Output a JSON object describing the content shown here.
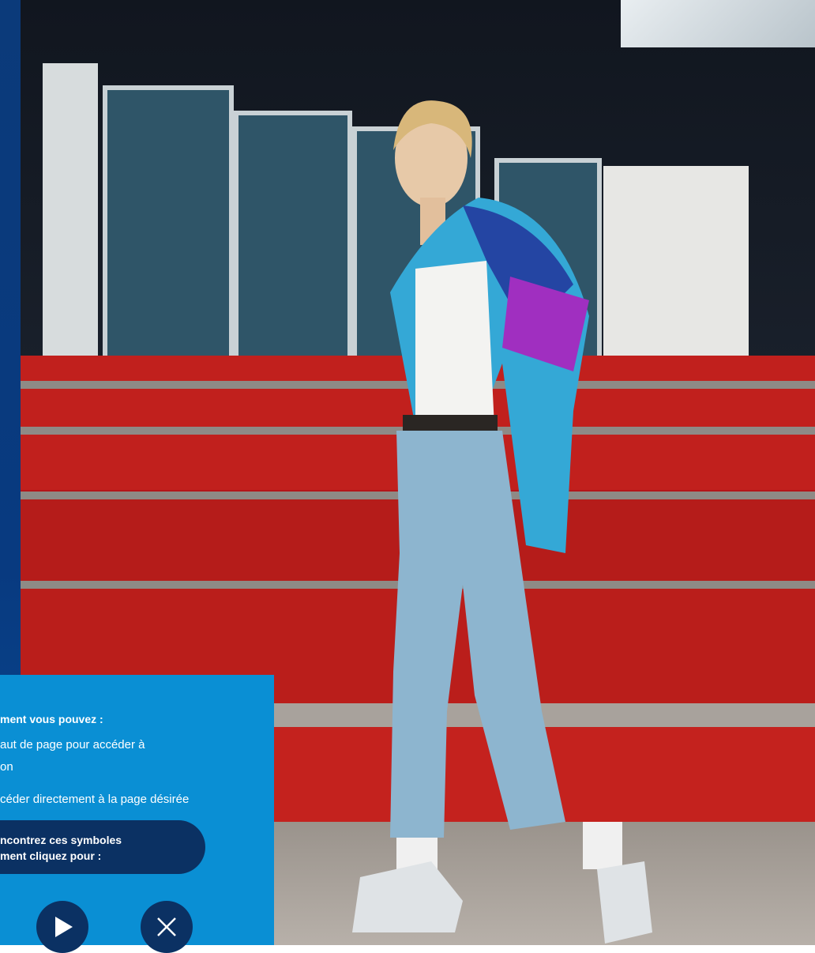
{
  "colors": {
    "panel": "#0a8fd4",
    "pill": "#0b3163",
    "strip": "#083a80",
    "steps": "#c1201d"
  },
  "info": {
    "heading": "ment vous pouvez :",
    "line1a": "aut de page pour accéder à",
    "line1b": "on",
    "line2": "céder directement à la page désirée",
    "pill_line1": "ncontrez ces symboles",
    "pill_line2": "ment cliquez pour :"
  },
  "buttons": {
    "play_icon": "play-icon",
    "close_icon": "close-icon"
  }
}
